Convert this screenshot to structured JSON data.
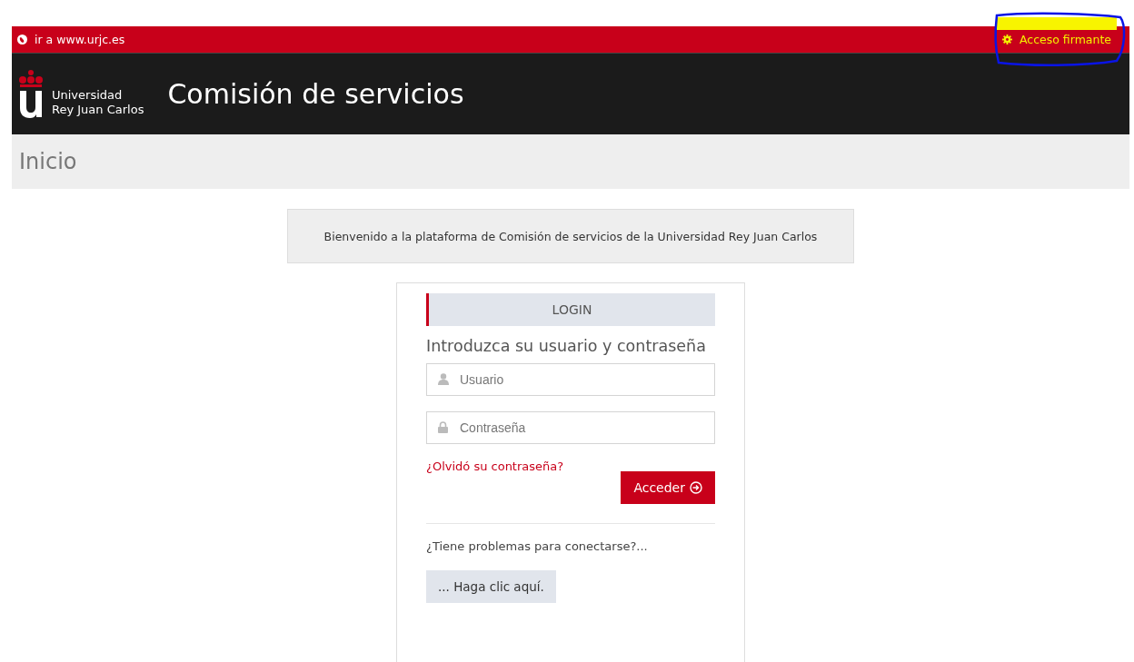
{
  "top_bar": {
    "site_link": "ir a www.urjc.es",
    "signer_link": "Acceso firmante"
  },
  "header": {
    "logo_lines": [
      "Universidad",
      "Rey Juan Carlos"
    ],
    "title": "Comisión de servicios"
  },
  "breadcrumb": "Inicio",
  "welcome": "Bienvenido a la plataforma de Comisión de servicios de la Universidad Rey Juan Carlos",
  "login": {
    "tab": "LOGIN",
    "heading": "Introduzca su usuario y contraseña",
    "fields": [
      {
        "kind": "user",
        "placeholder": "Usuario"
      },
      {
        "kind": "password",
        "placeholder": "Contraseña"
      }
    ],
    "forgot_link": "¿Olvidó su contraseña?",
    "submit": "Acceder",
    "help_text": "¿Tiene problemas para conectarse?...",
    "help_button": "... Haga clic aquí."
  }
}
